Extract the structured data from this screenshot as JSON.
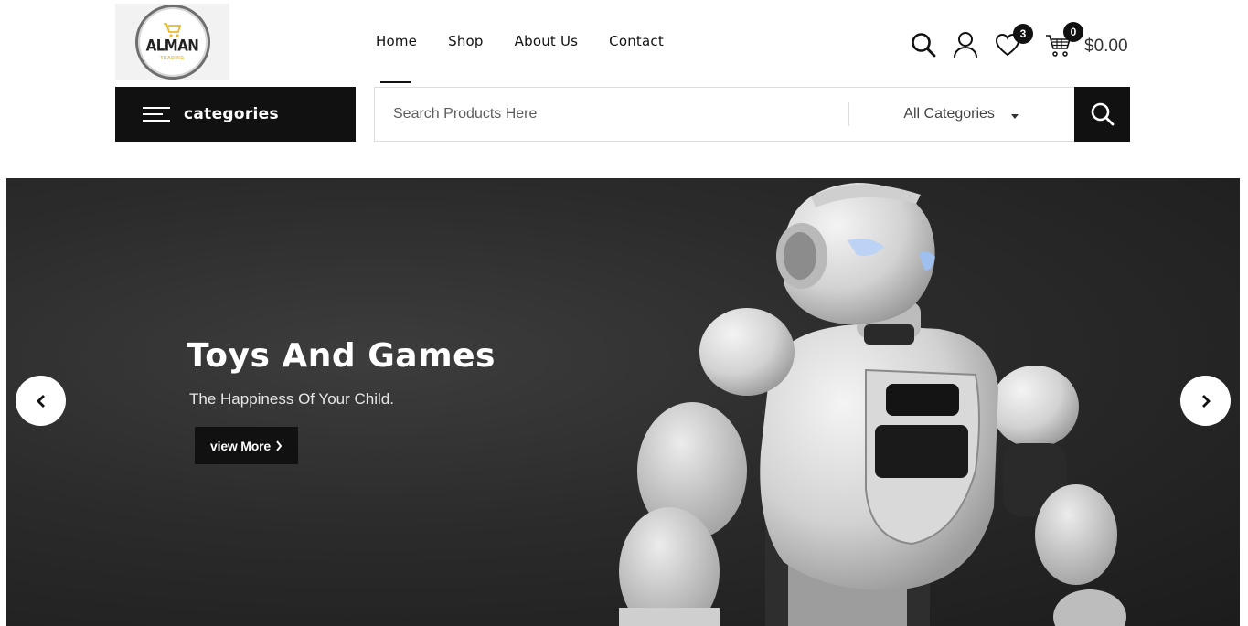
{
  "brand": {
    "logo_text": "ALMAN",
    "logo_sub": "TRADING",
    "accent": "#e9b92b"
  },
  "nav": {
    "items": [
      {
        "label": "Home",
        "active": true
      },
      {
        "label": "Shop",
        "active": false
      },
      {
        "label": "About Us",
        "active": false
      },
      {
        "label": "Contact",
        "active": false
      }
    ]
  },
  "header": {
    "icons": [
      "search-icon",
      "user-icon",
      "heart-icon",
      "cart-icon"
    ],
    "wishlist_count": "3",
    "cart_count": "0",
    "cart_total": "$0.00"
  },
  "categories": {
    "label": "categories",
    "icon": "hamburger-icon"
  },
  "search": {
    "placeholder": "Search Products Here",
    "category_selected": "All Categories",
    "button_icon": "search-icon"
  },
  "hero": {
    "title": "Toys And Games",
    "subtitle": "The Happiness Of Your Child.",
    "button_label": "view More",
    "prev_icon": "chevron-left-icon",
    "next_icon": "chevron-right-icon",
    "background": "#2b2b2b"
  }
}
